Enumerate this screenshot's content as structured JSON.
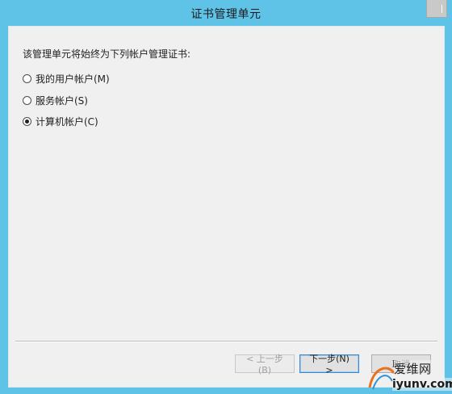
{
  "window": {
    "title": "证书管理单元"
  },
  "page": {
    "prompt": "该管理单元将始终为下列帐户管理证书:",
    "options": [
      {
        "label": "我的用户帐户(M)",
        "checked": false
      },
      {
        "label": "服务帐户(S)",
        "checked": false
      },
      {
        "label": "计算机帐户(C)",
        "checked": true
      }
    ]
  },
  "buttons": {
    "back": "< 上一步(B)",
    "next": "下一步(N) >",
    "cancel": "取消"
  },
  "watermark": {
    "text": "爱维网",
    "url": "iyunv.com"
  }
}
